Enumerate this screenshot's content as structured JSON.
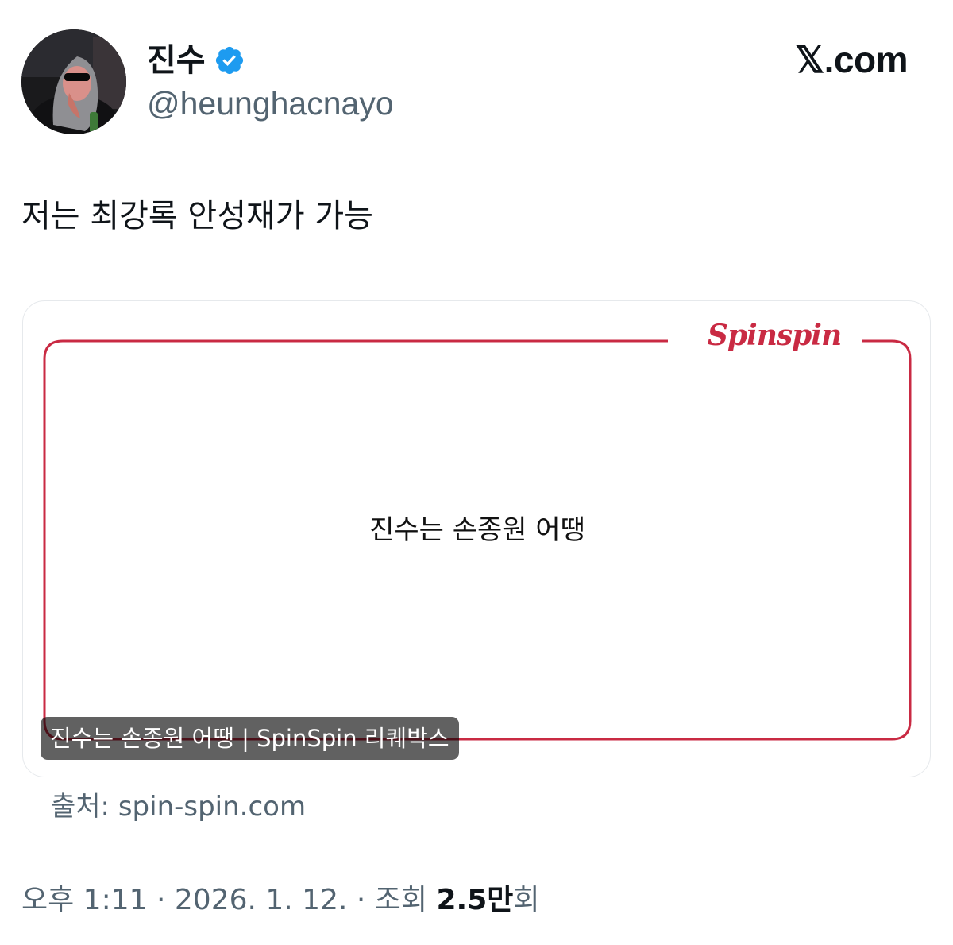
{
  "author": {
    "display_name": "진수",
    "handle": "@heunghacnayo",
    "verified": true,
    "avatar_icon": "sunglasses-figure-avatar",
    "verified_color": "#1d9bf0"
  },
  "brand": "𝕏.com",
  "tweet": {
    "text": "저는 최강록 안성재가 가능"
  },
  "card": {
    "logo": "Spinspin",
    "message": "진수는 손종원 어땡",
    "caption": "진수는 손종원 어땡 | SpinSpin 리퀘박스",
    "frame_color": "#c92a43"
  },
  "source": "출처: spin-spin.com",
  "meta": {
    "time": "오후 1:11",
    "separator": "·",
    "date": "2026. 1. 12.",
    "views_label": "조회",
    "views_count": "2.5만",
    "views_suffix": "회"
  }
}
